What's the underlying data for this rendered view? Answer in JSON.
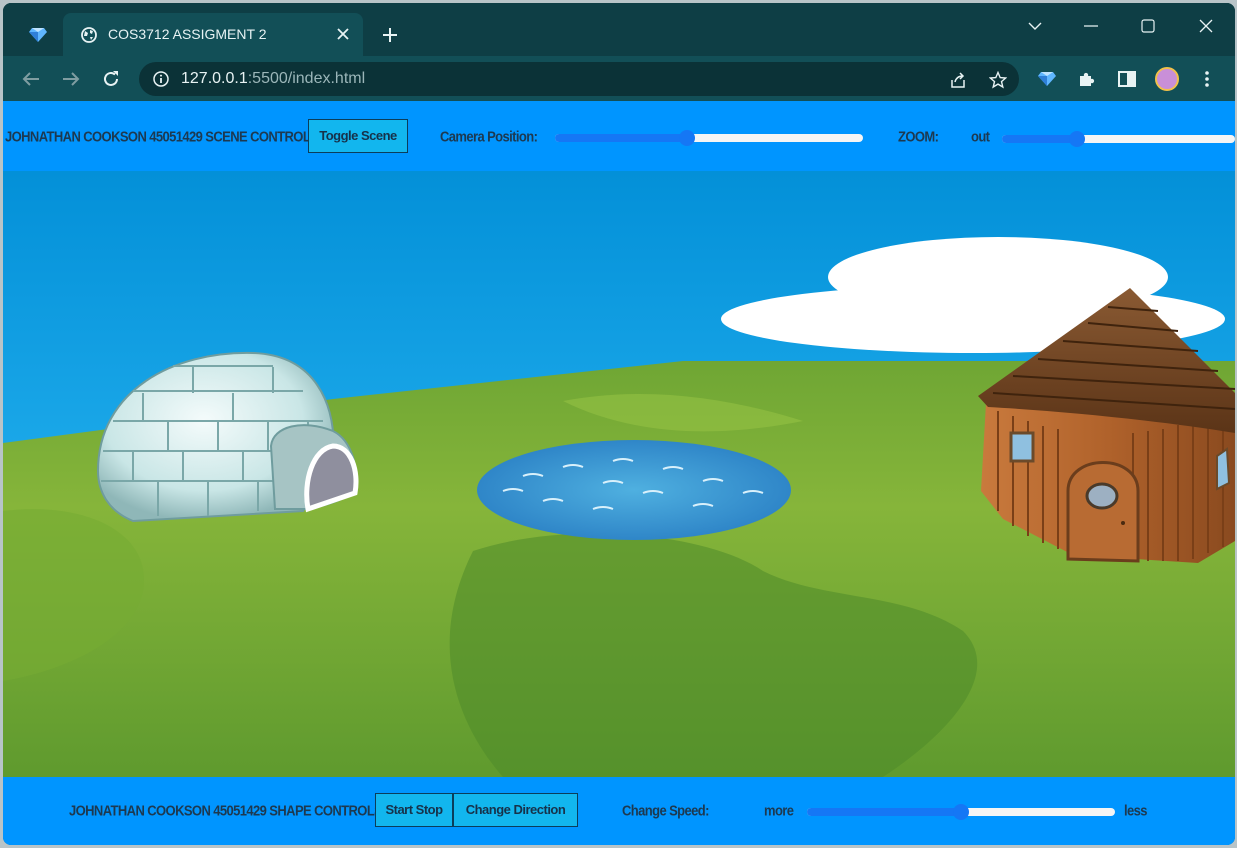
{
  "browser": {
    "tab_title": "COS3712 ASSIGMENT 2",
    "url_host": "127.0.0.1",
    "url_path": ":5500/index.html",
    "icons": {
      "pinned_tab": "gem-icon",
      "tab_favicon": "globe-icon",
      "tab_close": "close-icon",
      "new_tab": "plus-icon",
      "tab_search": "chevron-down-icon",
      "minimize": "minimize-icon",
      "maximize": "maximize-icon",
      "close_window": "close-icon",
      "back": "arrow-left-icon",
      "forward": "arrow-right-icon",
      "reload": "reload-icon",
      "site_info": "info-icon",
      "share": "share-icon",
      "bookmark": "star-icon",
      "extension_gem": "gem-icon",
      "extensions": "puzzle-icon",
      "side_panel": "side-panel-icon",
      "profile": "avatar",
      "menu": "kebab-menu-icon"
    }
  },
  "top_controls": {
    "label": "JOHNATHAN COOKSON 45051429 SCENE CONTROLS:",
    "toggle_button": "Toggle Scene",
    "camera_label": "Camera Position:",
    "camera_value": 0.43,
    "zoom_label": "ZOOM:",
    "zoom_out_label": "out",
    "zoom_value": 0.32
  },
  "bottom_controls": {
    "label": "JOHNATHAN COOKSON 45051429 SHAPE CONTROLS:",
    "start_stop_button": "Start Stop",
    "direction_button": "Change Direction",
    "speed_label": "Change Speed:",
    "more_label": "more",
    "less_label": "less",
    "speed_value": 0.5
  },
  "colors": {
    "frame": "#0e3e45",
    "toolbar": "#124f57",
    "page_background": "#0095ff",
    "button": "#12b6ee",
    "slider": "#1577f5"
  }
}
